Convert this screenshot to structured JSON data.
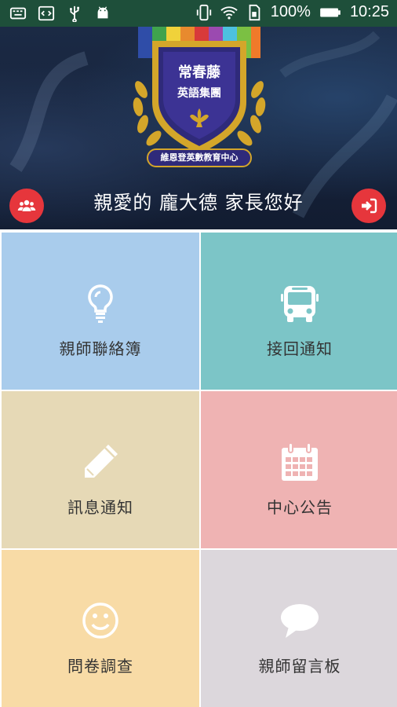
{
  "status_bar": {
    "battery_percent": "100%",
    "time": "10:25",
    "left_icons": [
      "keyboard-icon",
      "code-icon",
      "usb-icon",
      "android-icon"
    ],
    "right_icons": [
      "vibrate-icon",
      "wifi-icon",
      "sim-icon",
      "battery-icon"
    ]
  },
  "header": {
    "logo": {
      "brand_name": "常春藤",
      "group_name": "英語集團",
      "center_name": "維恩登英數教育中心"
    },
    "greeting": "親愛的 龐大德 家長您好",
    "users_button_icon": "users-icon",
    "logout_button_icon": "logout-icon"
  },
  "tiles": [
    {
      "label": "親師聯絡簿",
      "icon": "lightbulb-icon",
      "color": "#a9ccec"
    },
    {
      "label": "接回通知",
      "icon": "bus-icon",
      "color": "#7cc5c7"
    },
    {
      "label": "訊息通知",
      "icon": "pencil-icon",
      "color": "#e6d9b6"
    },
    {
      "label": "中心公告",
      "icon": "calendar-icon",
      "color": "#efb3b3"
    },
    {
      "label": "問卷調查",
      "icon": "smiley-icon",
      "color": "#f8dba6"
    },
    {
      "label": "親師留言板",
      "icon": "chat-bubble-icon",
      "color": "#dcd7dc"
    }
  ]
}
